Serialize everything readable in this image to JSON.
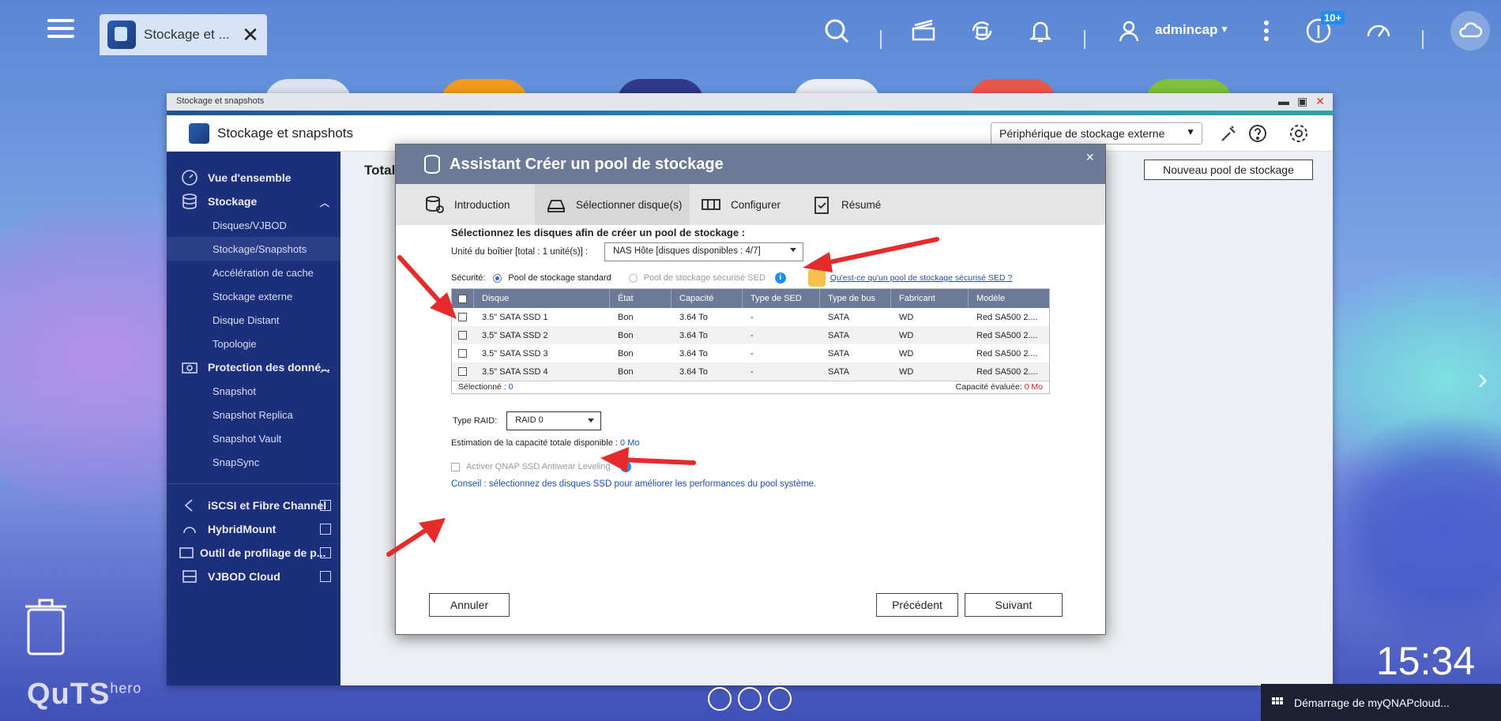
{
  "topbar": {
    "app_tab_title": "Stockage et ...",
    "username": "admincap",
    "notif_badge": "10+"
  },
  "window": {
    "titlebar": "Stockage et snapshots",
    "header_title": "Stockage et snapshots",
    "external_device_select": "Périphérique de stockage externe"
  },
  "sidebar": {
    "items": [
      {
        "label": "Vue d'ensemble"
      },
      {
        "label": "Stockage"
      },
      {
        "label": "Disques/VJBOD"
      },
      {
        "label": "Stockage/Snapshots"
      },
      {
        "label": "Accélération de cache"
      },
      {
        "label": "Stockage externe"
      },
      {
        "label": "Disque Distant"
      },
      {
        "label": "Topologie"
      },
      {
        "label": "Protection des donné..."
      },
      {
        "label": "Snapshot"
      },
      {
        "label": "Snapshot Replica"
      },
      {
        "label": "Snapshot Vault"
      },
      {
        "label": "SnapSync"
      },
      {
        "label": "iSCSI et Fibre Channel"
      },
      {
        "label": "HybridMount"
      },
      {
        "label": "Outil de profilage de p..."
      },
      {
        "label": "VJBOD Cloud"
      }
    ]
  },
  "content": {
    "total_label": "Total",
    "new_pool_button": "Nouveau pool de stockage"
  },
  "dialog": {
    "title": "Assistant Créer un pool de stockage",
    "close": "×",
    "steps": [
      "Introduction",
      "Sélectionner disque(s)",
      "Configurer",
      "Résumé"
    ],
    "heading": "Sélectionnez les disques afin de créer un pool de stockage :",
    "enclosure_label": "Unité du boîtier [total : 1 unité(s)] :",
    "enclosure_value": "NAS Hôte [disques disponibles : 4/7]",
    "security_label": "Sécurité:",
    "security_standard": "Pool de stockage standard",
    "security_sed": "Pool de stockage sécurisé SED",
    "sed_link": "Qu'est-ce qu'un pool de stockage sécurisé SED ?",
    "table_headers": [
      "Disque",
      "État",
      "Capacité",
      "Type de SED",
      "Type de bus",
      "Fabricant",
      "Modèle"
    ],
    "disks": [
      {
        "name": "3.5\" SATA SSD 1",
        "state": "Bon",
        "capacity": "3.64 To",
        "sed": "-",
        "bus": "SATA",
        "vendor": "WD",
        "model": "Red SA500 2...."
      },
      {
        "name": "3.5\" SATA SSD 2",
        "state": "Bon",
        "capacity": "3.64 To",
        "sed": "-",
        "bus": "SATA",
        "vendor": "WD",
        "model": "Red SA500 2...."
      },
      {
        "name": "3.5\" SATA SSD 3",
        "state": "Bon",
        "capacity": "3.64 To",
        "sed": "-",
        "bus": "SATA",
        "vendor": "WD",
        "model": "Red SA500 2...."
      },
      {
        "name": "3.5\" SATA SSD 4",
        "state": "Bon",
        "capacity": "3.64 To",
        "sed": "-",
        "bus": "SATA",
        "vendor": "WD",
        "model": "Red SA500 2...."
      }
    ],
    "selected_label": "Sélectionné :",
    "selected_value": "0",
    "capacity_eval_label": "Capacité évaluée:",
    "capacity_eval_value": "0 Mo",
    "raid_label": "Type RAID:",
    "raid_value": "RAID 0",
    "estimate_label": "Estimation de la capacité totale disponible :",
    "estimate_value": "0 Mo",
    "antiwear_label": "Activer QNAP SSD Antiwear Leveling",
    "tip": "Conseil : sélectionnez des disques SSD pour améliorer les performances du pool système.",
    "cancel": "Annuler",
    "previous": "Précédent",
    "next": "Suivant"
  },
  "desktop": {
    "logo": "QuTS",
    "logo_sup": "hero",
    "clock": "15:34",
    "notification": "Démarrage de myQNAPcloud..."
  }
}
